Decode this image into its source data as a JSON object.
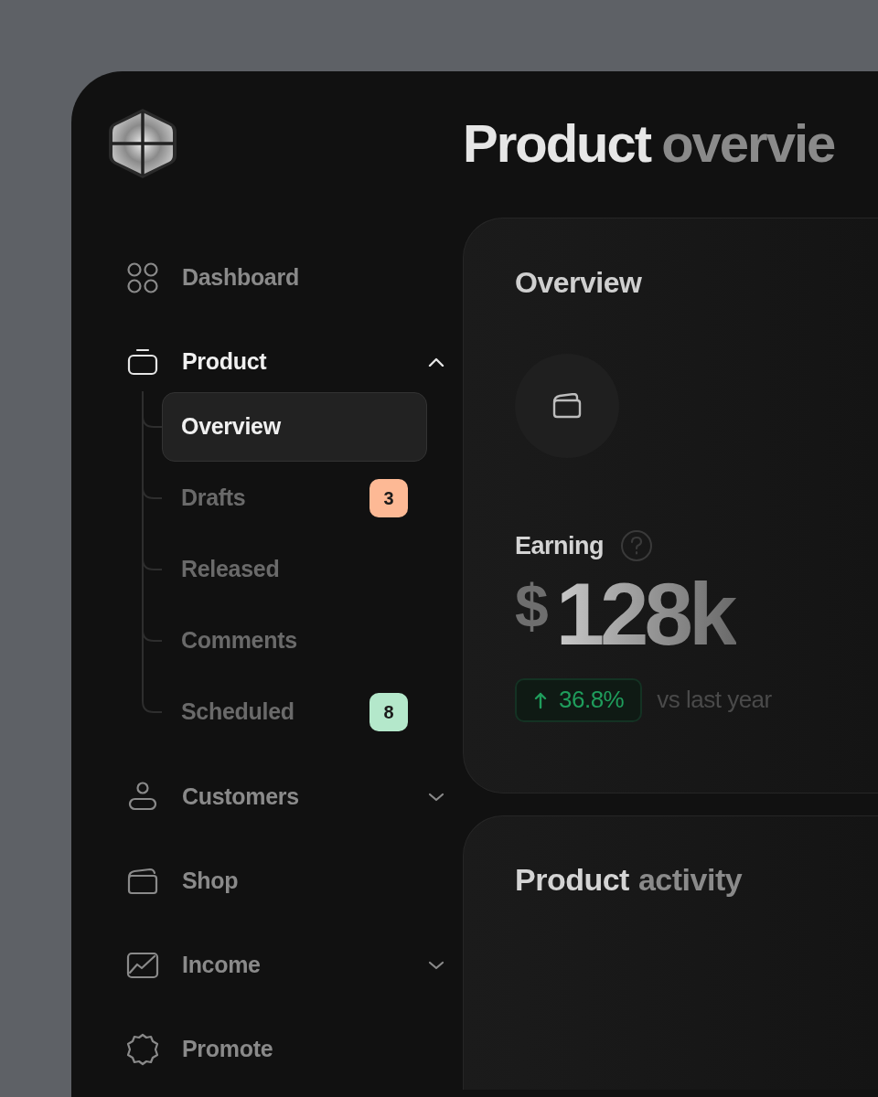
{
  "header": {
    "title_main": "Product",
    "title_rest": "overvie"
  },
  "sidebar": {
    "items": [
      {
        "label": "Dashboard"
      },
      {
        "label": "Product",
        "expanded": true,
        "children": [
          {
            "label": "Overview",
            "selected": true
          },
          {
            "label": "Drafts",
            "selected": false,
            "badge": {
              "text": "3",
              "color": "#fdb995"
            }
          },
          {
            "label": "Released",
            "selected": false
          },
          {
            "label": "Comments",
            "selected": false
          },
          {
            "label": "Scheduled",
            "selected": false,
            "badge": {
              "text": "8",
              "color": "#b4e8cb"
            }
          }
        ]
      },
      {
        "label": "Customers",
        "expanded": false
      },
      {
        "label": "Shop"
      },
      {
        "label": "Income",
        "expanded": false
      },
      {
        "label": "Promote"
      }
    ]
  },
  "overview_card": {
    "title": "Overview",
    "metric": {
      "label": "Earning",
      "currency": "$",
      "value": "128k",
      "change": "36.8%",
      "comparison": "vs last year"
    }
  },
  "activity_card": {
    "title_main": "Product",
    "title_rest": "activity"
  }
}
